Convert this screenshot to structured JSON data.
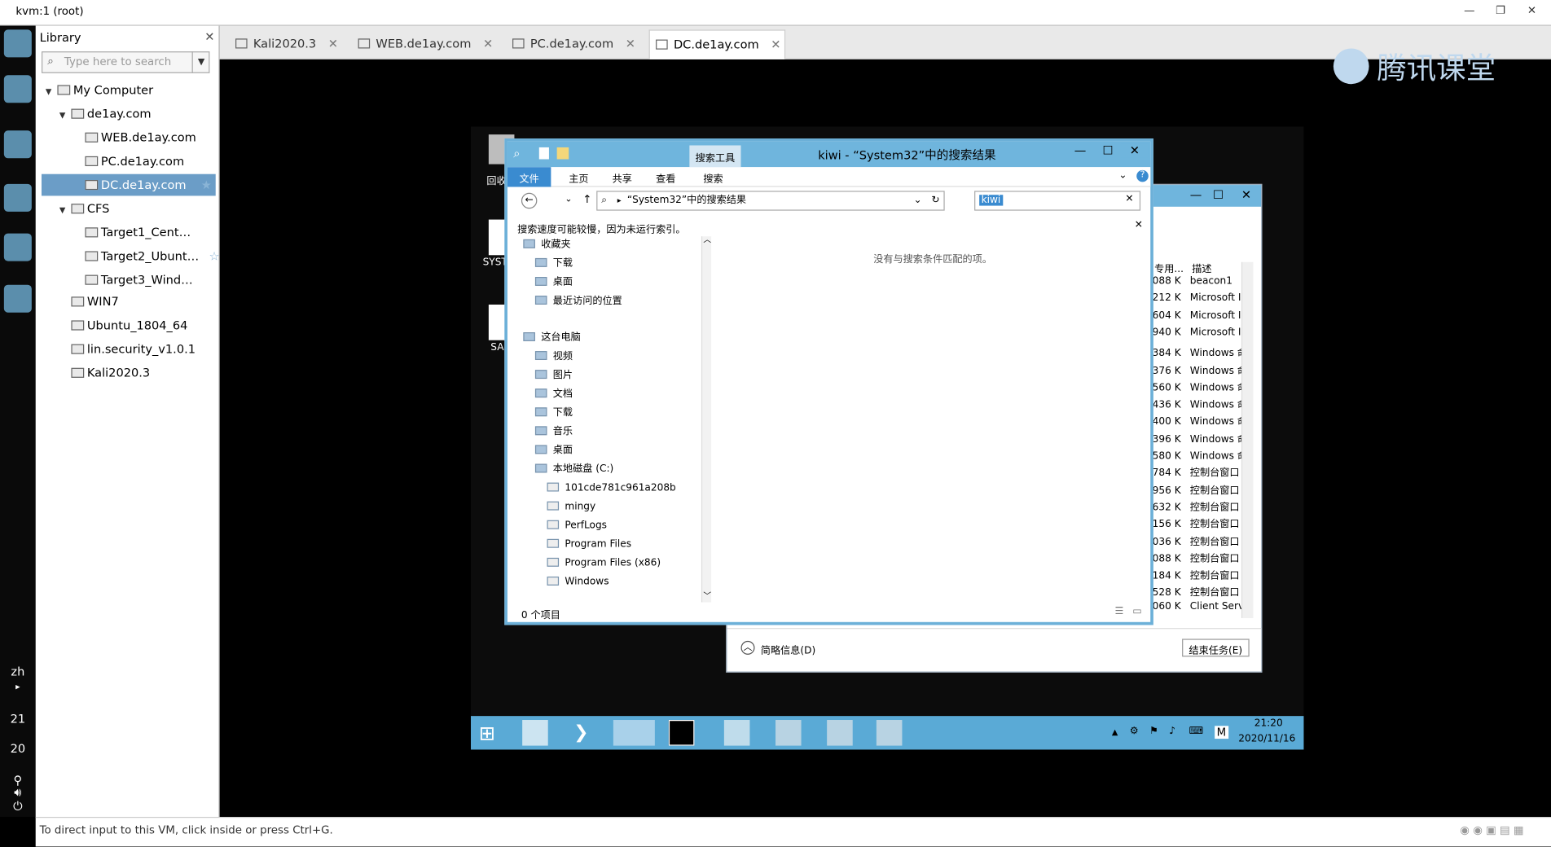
{
  "window": {
    "title": "kvm:1 (root)"
  },
  "library": {
    "title": "Library",
    "search_placeholder": "Type here to search",
    "items": [
      {
        "label": "My Computer"
      },
      {
        "label": "de1ay.com"
      },
      {
        "label": "WEB.de1ay.com"
      },
      {
        "label": "PC.de1ay.com"
      },
      {
        "label": "DC.de1ay.com"
      },
      {
        "label": "CFS"
      },
      {
        "label": "Target1_Cent…"
      },
      {
        "label": "Target2_Ubunt…"
      },
      {
        "label": "Target3_Wind…"
      },
      {
        "label": "WIN7"
      },
      {
        "label": "Ubuntu_1804_64"
      },
      {
        "label": "lin.security_v1.0.1"
      },
      {
        "label": "Kali2020.3"
      }
    ]
  },
  "dock": {
    "lang": "zh",
    "time_h": "21",
    "time_m": "20"
  },
  "vm_tabs": [
    {
      "label": "Kali2020.3"
    },
    {
      "label": "WEB.de1ay.com"
    },
    {
      "label": "PC.de1ay.com"
    },
    {
      "label": "DC.de1ay.com"
    }
  ],
  "watermark": "腾讯课堂",
  "explorer": {
    "title": "kiwi - “System32”中的搜索结果",
    "tool_tab": "搜索工具",
    "ribbon": [
      "文件",
      "主页",
      "共享",
      "查看",
      "搜索"
    ],
    "address": "“System32”中的搜索结果",
    "search_value": "kiwi",
    "info_bar": "搜索速度可能较慢，因为未运行索引。",
    "empty_msg": "没有与搜索条件匹配的项。",
    "nav": [
      {
        "label": "收藏夹",
        "level": 0
      },
      {
        "label": "下载",
        "level": 1
      },
      {
        "label": "桌面",
        "level": 1
      },
      {
        "label": "最近访问的位置",
        "level": 1
      },
      {
        "label": "这台电脑",
        "level": 0
      },
      {
        "label": "视频",
        "level": 1
      },
      {
        "label": "图片",
        "level": 1
      },
      {
        "label": "文档",
        "level": 1
      },
      {
        "label": "下载",
        "level": 1
      },
      {
        "label": "音乐",
        "level": 1
      },
      {
        "label": "桌面",
        "level": 1
      },
      {
        "label": "本地磁盘 (C:)",
        "level": 1
      },
      {
        "label": "101cde781c961a208b",
        "level": 2
      },
      {
        "label": "mingy",
        "level": 2
      },
      {
        "label": "PerfLogs",
        "level": 2
      },
      {
        "label": "Program Files",
        "level": 2
      },
      {
        "label": "Program Files (x86)",
        "level": 2
      },
      {
        "label": "Windows",
        "level": 2
      }
    ],
    "status": "0 个项目"
  },
  "taskmgr": {
    "col_mem": "专用...",
    "col_desc": "描述",
    "rows": [
      [
        "088 K",
        "beacon1"
      ],
      [
        "212 K",
        "Microsoft I"
      ],
      [
        "604 K",
        "Microsoft I"
      ],
      [
        "940 K",
        "Microsoft I"
      ],
      [
        "384 K",
        "Windows 命"
      ],
      [
        "376 K",
        "Windows 命"
      ],
      [
        "560 K",
        "Windows 命"
      ],
      [
        "436 K",
        "Windows 命"
      ],
      [
        "400 K",
        "Windows 命"
      ],
      [
        "396 K",
        "Windows 命"
      ],
      [
        "580 K",
        "Windows 命"
      ],
      [
        "784 K",
        "控制台窗口"
      ],
      [
        "956 K",
        "控制台窗口"
      ],
      [
        "632 K",
        "控制台窗口"
      ],
      [
        "156 K",
        "控制台窗口"
      ],
      [
        "036 K",
        "控制台窗口"
      ],
      [
        "088 K",
        "控制台窗口"
      ],
      [
        "184 K",
        "控制台窗口"
      ],
      [
        "528 K",
        "控制台窗口"
      ],
      [
        "060 K",
        "Client Serv"
      ]
    ],
    "fewer_details": "简略信息(D)",
    "end_task": "结束任务(E)"
  },
  "desktop": {
    "icons": [
      "回收",
      "SYST",
      "SA"
    ]
  },
  "guest_taskbar": {
    "time": "21:20",
    "date": "2020/11/16",
    "ime": "M"
  },
  "statusbar": "To direct input to this VM, click inside or press Ctrl+G."
}
